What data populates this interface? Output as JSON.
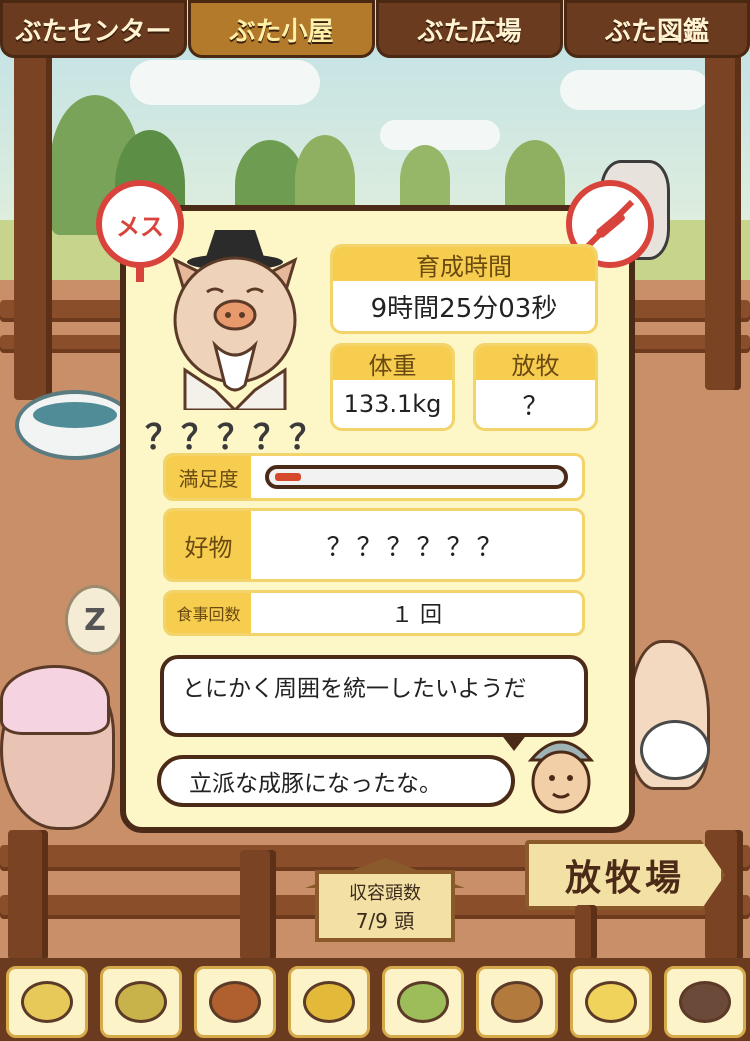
{
  "tabs": [
    {
      "label": "ぶたセンター",
      "active": false
    },
    {
      "label": "ぶた小屋",
      "active": true
    },
    {
      "label": "ぶた広場",
      "active": false
    },
    {
      "label": "ぶた図鑑",
      "active": false
    }
  ],
  "pig": {
    "gender": "メス",
    "name": "？？？？？"
  },
  "stats": {
    "growth_time_label": "育成時間",
    "growth_time_value": "9時間25分03秒",
    "weight_label": "体重",
    "weight_value": "133.1kg",
    "pasture_label": "放牧",
    "pasture_value": "？"
  },
  "satisfaction": {
    "label": "満足度",
    "level": 0.1
  },
  "favorite": {
    "label": "好物",
    "value": "？？？？？？"
  },
  "meals": {
    "label": "食事回数",
    "value": "１ 回"
  },
  "messages": {
    "pig_thought": "とにかく周囲を統一したいようだ",
    "farmer_says": "立派な成豚になったな。"
  },
  "capacity": {
    "label": "収容頭数",
    "value": "7/9 頭"
  },
  "pasture_sign": "放牧場",
  "food_items": [
    "grain-icon",
    "mixed-grain-icon",
    "sweet-potato-icon",
    "corn-icon",
    "beans-icon",
    "acorn-icon",
    "rice-bowl-icon",
    "truffle-icon"
  ],
  "colors": {
    "accent": "#f6cd4e",
    "border": "#4b2b17",
    "badge_red": "#d8443b"
  }
}
